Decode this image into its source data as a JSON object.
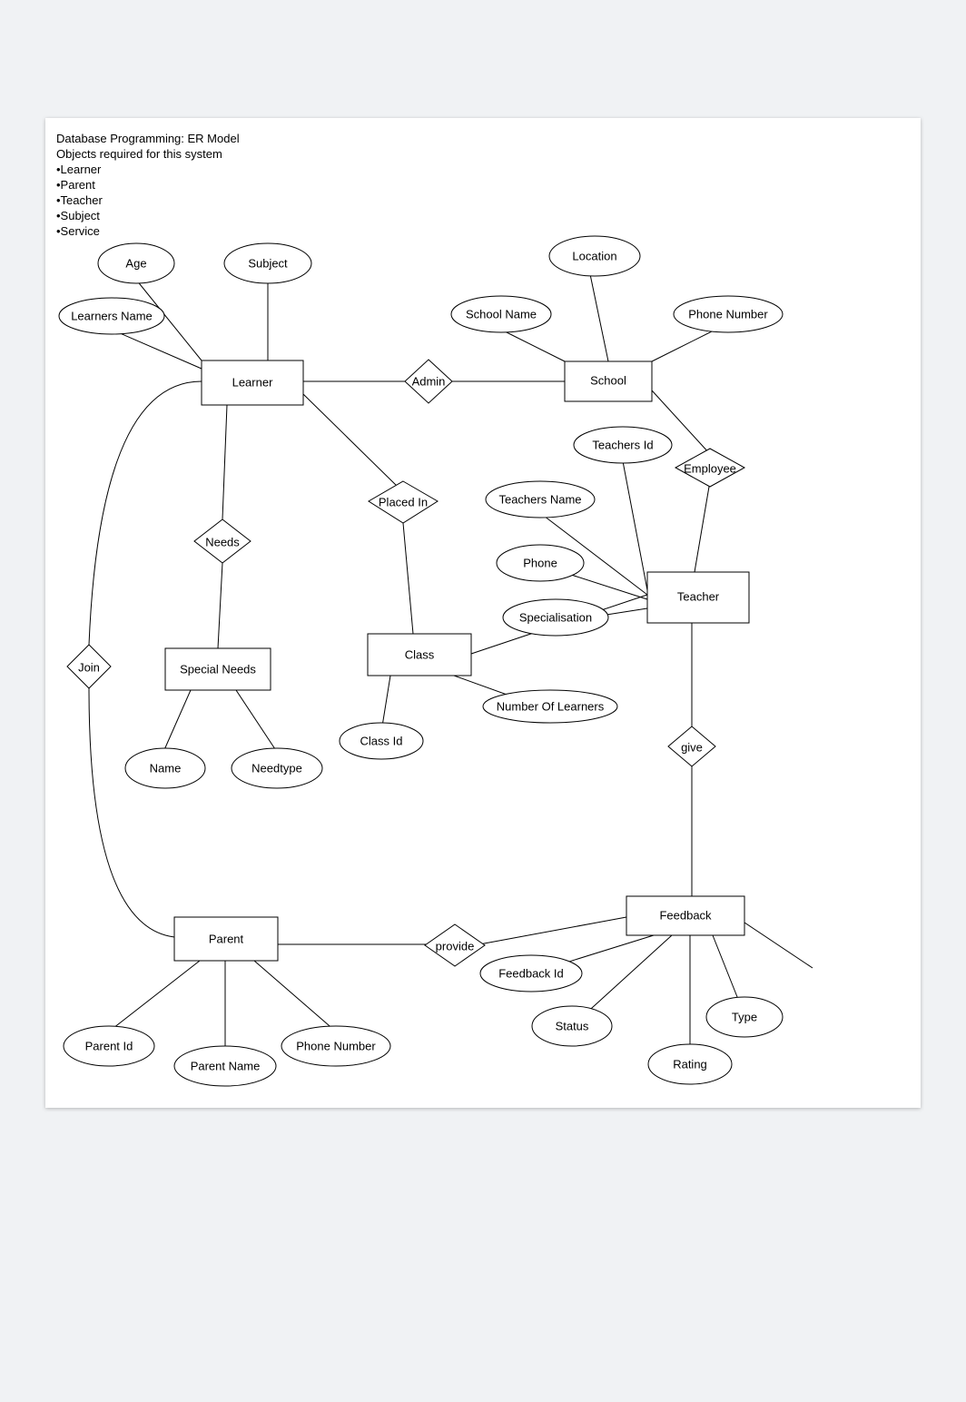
{
  "heading": {
    "title": "Database Programming: ER Model",
    "subtitle": "Objects required for this system",
    "bullets": [
      "•Learner",
      "•Parent",
      "•Teacher",
      "•Subject",
      "•Service"
    ]
  },
  "entities": {
    "learner": "Learner",
    "school": "School",
    "special_needs": "Special Needs",
    "class": "Class",
    "teacher": "Teacher",
    "parent": "Parent",
    "feedback": "Feedback"
  },
  "relationships": {
    "admin": "Admin",
    "placed_in": "Placed In",
    "needs": "Needs",
    "join": "Join",
    "employee": "Employee",
    "give": "give",
    "provide": "provide"
  },
  "attributes": {
    "age": "Age",
    "subject": "Subject",
    "learners_name": "Learners Name",
    "location": "Location",
    "school_name": "School Name",
    "phone_number_school": "Phone Number",
    "teachers_id": "Teachers Id",
    "teachers_name": "Teachers Name",
    "phone": "Phone",
    "specialisation": "Specialisation",
    "name": "Name",
    "needtype": "Needtype",
    "class_id": "Class Id",
    "number_of_learners": "Number Of Learners",
    "parent_id": "Parent Id",
    "parent_name": "Parent Name",
    "phone_number_parent": "Phone Number",
    "feedback_id": "Feedback Id",
    "status": "Status",
    "rating": "Rating",
    "type": "Type"
  }
}
